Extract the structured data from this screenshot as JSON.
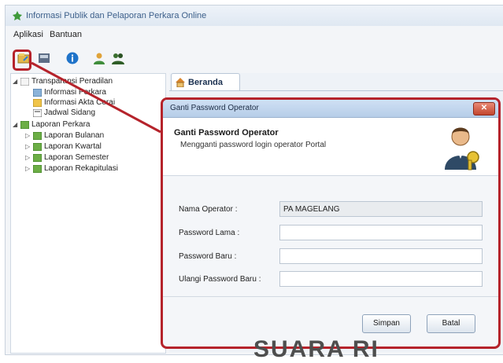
{
  "window": {
    "title": "Informasi Publik dan Pelaporan Perkara Online"
  },
  "menu": {
    "items": [
      "Aplikasi",
      "Bantuan"
    ]
  },
  "toolbar": {
    "icons": [
      "change-password-icon",
      "document-icon",
      "info-icon",
      "user-icon",
      "group-icon"
    ]
  },
  "tree": {
    "items": [
      {
        "label": "Transparansi Peradilan",
        "icon": "folder-icon"
      },
      {
        "label": "Informasi Perkara",
        "icon": "page-icon"
      },
      {
        "label": "Informasi Akta Cerai",
        "icon": "page-icon"
      },
      {
        "label": "Jadwal Sidang",
        "icon": "page-icon"
      },
      {
        "label": "Laporan Perkara",
        "icon": "folder-icon"
      },
      {
        "label": "Laporan Bulanan",
        "icon": "folder-icon"
      },
      {
        "label": "Laporan Kwartal",
        "icon": "folder-icon"
      },
      {
        "label": "Laporan Semester",
        "icon": "folder-icon"
      },
      {
        "label": "Laporan Rekapitulasi",
        "icon": "folder-icon"
      }
    ]
  },
  "tab": {
    "label": "Beranda"
  },
  "dialog": {
    "title": "Ganti Password Operator",
    "heading": "Ganti Password Operator",
    "subheading": "Mengganti password login operator Portal",
    "fields": [
      {
        "label": "Nama Operator :",
        "value": "PA MAGELANG"
      },
      {
        "label": "Password Lama :",
        "value": ""
      },
      {
        "label": "Password Baru :",
        "value": ""
      },
      {
        "label": "Ulangi Password Baru :",
        "value": ""
      }
    ],
    "buttons": {
      "save": "Simpan",
      "cancel": "Batal"
    },
    "close_icon": "close-icon"
  },
  "watermark": {
    "text": "SUARA RI"
  },
  "colors": {
    "highlight": "#b5232b",
    "accent": "#3c5f8a"
  }
}
